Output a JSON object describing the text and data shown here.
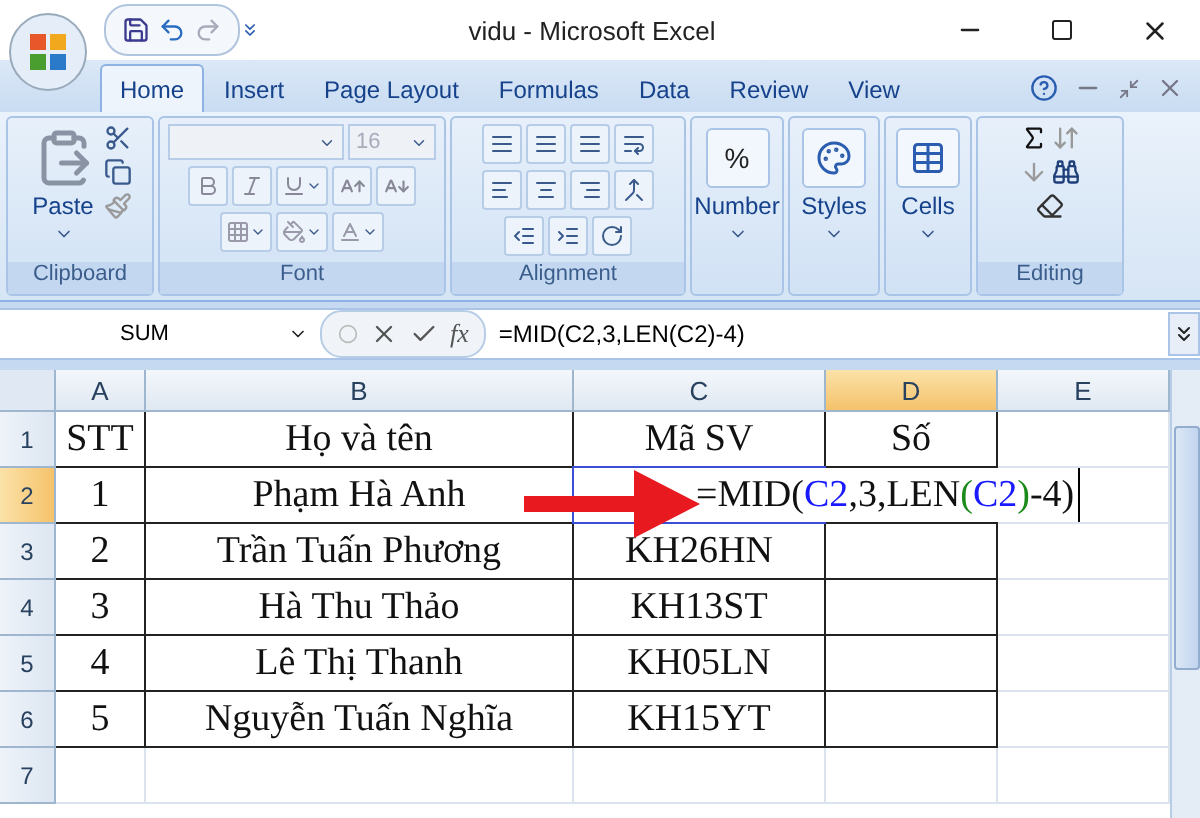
{
  "window": {
    "title": "vidu - Microsoft Excel"
  },
  "tabs": [
    {
      "label": "Home",
      "selected": true
    },
    {
      "label": "Insert",
      "selected": false
    },
    {
      "label": "Page Layout",
      "selected": false
    },
    {
      "label": "Formulas",
      "selected": false
    },
    {
      "label": "Data",
      "selected": false
    },
    {
      "label": "Review",
      "selected": false
    },
    {
      "label": "View",
      "selected": false
    }
  ],
  "ribbon": {
    "groups": [
      {
        "kind": "clipboard",
        "label": "Clipboard",
        "button": "Paste"
      },
      {
        "kind": "font",
        "label": "Font",
        "font_size": "16"
      },
      {
        "kind": "alignment",
        "label": "Alignment"
      },
      {
        "kind": "number",
        "button": "Number",
        "glyph": "%"
      },
      {
        "kind": "styles",
        "button": "Styles"
      },
      {
        "kind": "cells",
        "button": "Cells"
      },
      {
        "kind": "editing",
        "label": "Editing"
      }
    ]
  },
  "formula_bar": {
    "name_box": "SUM",
    "function_label": "fx",
    "formula": "=MID(C2,3,LEN(C2)-4)"
  },
  "sheet": {
    "columns": [
      {
        "label": "A",
        "selected": false
      },
      {
        "label": "B",
        "selected": false
      },
      {
        "label": "C",
        "selected": false
      },
      {
        "label": "D",
        "selected": true
      },
      {
        "label": "E",
        "selected": false
      }
    ],
    "rows": [
      {
        "number": "1",
        "selected": false,
        "in_table": true,
        "cells": [
          "STT",
          "Họ và tên",
          "Mã SV",
          "Số"
        ]
      },
      {
        "number": "2",
        "selected": true,
        "in_table": true,
        "cells": [
          "1",
          "Phạm Hà Anh"
        ],
        "editing": [
          {
            "text": "=MID("
          },
          {
            "text": "C2",
            "color": "#1a1aff"
          },
          {
            "text": ",3,LEN"
          },
          {
            "text": "(",
            "color": "#1a8a1a"
          },
          {
            "text": "C2",
            "color": "#1a1aff"
          },
          {
            "text": ")",
            "color": "#1a8a1a"
          },
          {
            "text": "-4)"
          }
        ]
      },
      {
        "number": "3",
        "selected": false,
        "in_table": true,
        "cells": [
          "2",
          "Trần Tuấn Phương",
          "KH26HN"
        ]
      },
      {
        "number": "4",
        "selected": false,
        "in_table": true,
        "cells": [
          "3",
          "Hà Thu Thảo",
          "KH13ST"
        ]
      },
      {
        "number": "5",
        "selected": false,
        "in_table": true,
        "cells": [
          "4",
          "Lê Thị Thanh",
          "KH05LN"
        ]
      },
      {
        "number": "6",
        "selected": false,
        "in_table": true,
        "cells": [
          "5",
          "Nguyễn Tuấn Nghĩa",
          "KH15YT"
        ]
      },
      {
        "number": "7",
        "selected": false,
        "in_table": false,
        "cells": []
      }
    ]
  }
}
